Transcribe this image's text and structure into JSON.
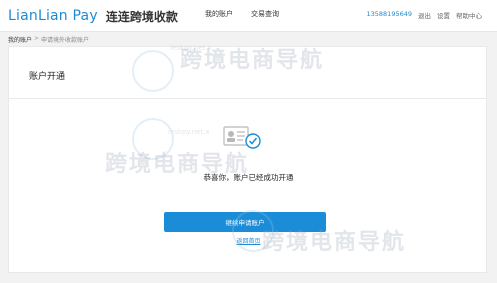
{
  "header": {
    "logo_en": "LianLian Pay",
    "logo_cn": "连连跨境收款",
    "nav": [
      "我的账户",
      "交易查询"
    ],
    "phone": "13588195649",
    "links": [
      "退出",
      "设置",
      "帮助中心"
    ]
  },
  "breadcrumb": {
    "root": "我的账户",
    "separator": ">",
    "current": "申请境外收款账户"
  },
  "card": {
    "title": "账户开通",
    "success_message": "恭喜你，账户已经成功开通",
    "primary_button": "继续申请账户",
    "secondary_link": "返回首页"
  },
  "watermark": {
    "text": "跨境电商导航",
    "url": "ieskpy.net.x"
  },
  "colors": {
    "accent": "#1a8cd8",
    "background": "#f2f2f2"
  }
}
